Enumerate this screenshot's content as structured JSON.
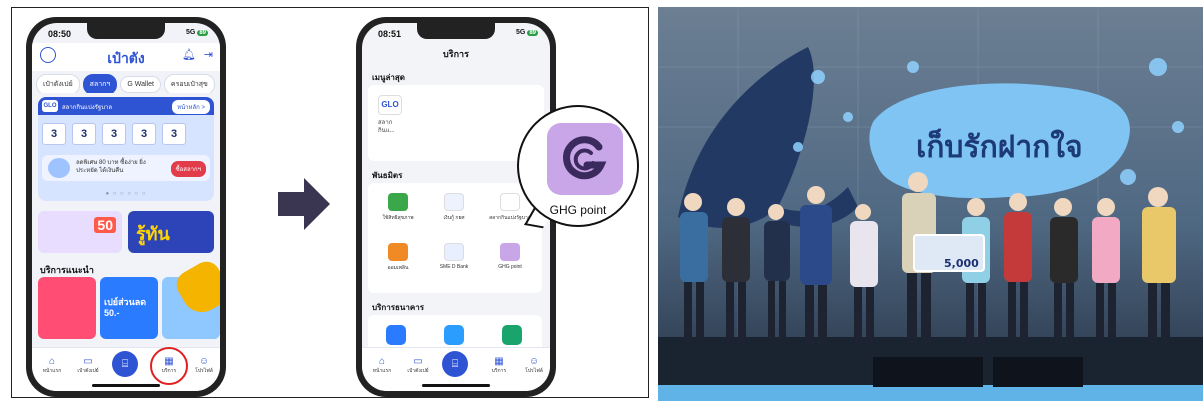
{
  "phone1": {
    "status_time": "08:50",
    "status_signal": "5G",
    "status_battery": "89",
    "title": "เป๋าตัง",
    "tabs": [
      "เป๋าตังเปย์",
      "สลากฯ",
      "G Wallet",
      "ครอบเป๋าสุข"
    ],
    "lottery": {
      "logo": "GLO",
      "title": "สลากกินแบ่งรัฐบาล",
      "link": "หน้าหลัก >",
      "digits": [
        "3",
        "3",
        "3",
        "3",
        "3",
        "3"
      ],
      "promo_text": "ลดพิเศษ 80 บาท ซื้อง่าย ยิ่งประหยัด ได้เงินคืน",
      "promo_button": "ซื้อสลากฯ"
    },
    "banner_right_text": "รู้ทัน",
    "banner_left_text": "50",
    "recommended_title": "บริการแนะนำ",
    "rec_cards": [
      "",
      "เปย์ส่วนลด 50.-",
      ""
    ],
    "nav": [
      "หน้าแรก",
      "เป๋าตังเปย์",
      "",
      "บริการ",
      "โปรไฟล์"
    ]
  },
  "phone2": {
    "status_time": "08:51",
    "status_signal": "5G",
    "status_battery": "89",
    "title": "บริการ",
    "recent_title": "เมนูล่าสุด",
    "recent_item_logo": "GLO",
    "recent_item_label": "สลาก กินแ...",
    "partners_title": "พันธมิตร",
    "partners": [
      "ใช้สิทธิสุขภาพ",
      "เงินกู้ กยศ",
      "สลากกินแบ่งรัฐบาล",
      "ออมเพลิน",
      "SME D Bank",
      "GHG point"
    ],
    "banking_title": "บริการธนาคาร",
    "nav": [
      "หน้าแรก",
      "เป๋าตังเปย์",
      "",
      "บริการ",
      "โปรไฟล์"
    ]
  },
  "callout": {
    "label": "GHG point"
  },
  "photo": {
    "sign_text": "เก็บรักฝากใจ",
    "cheque_amount": "5,000"
  },
  "colors": {
    "brand_blue": "#2f54d3",
    "ghg_purple": "#c9a6e8",
    "highlight_red": "#e02020",
    "arrow": "#3a3550"
  }
}
